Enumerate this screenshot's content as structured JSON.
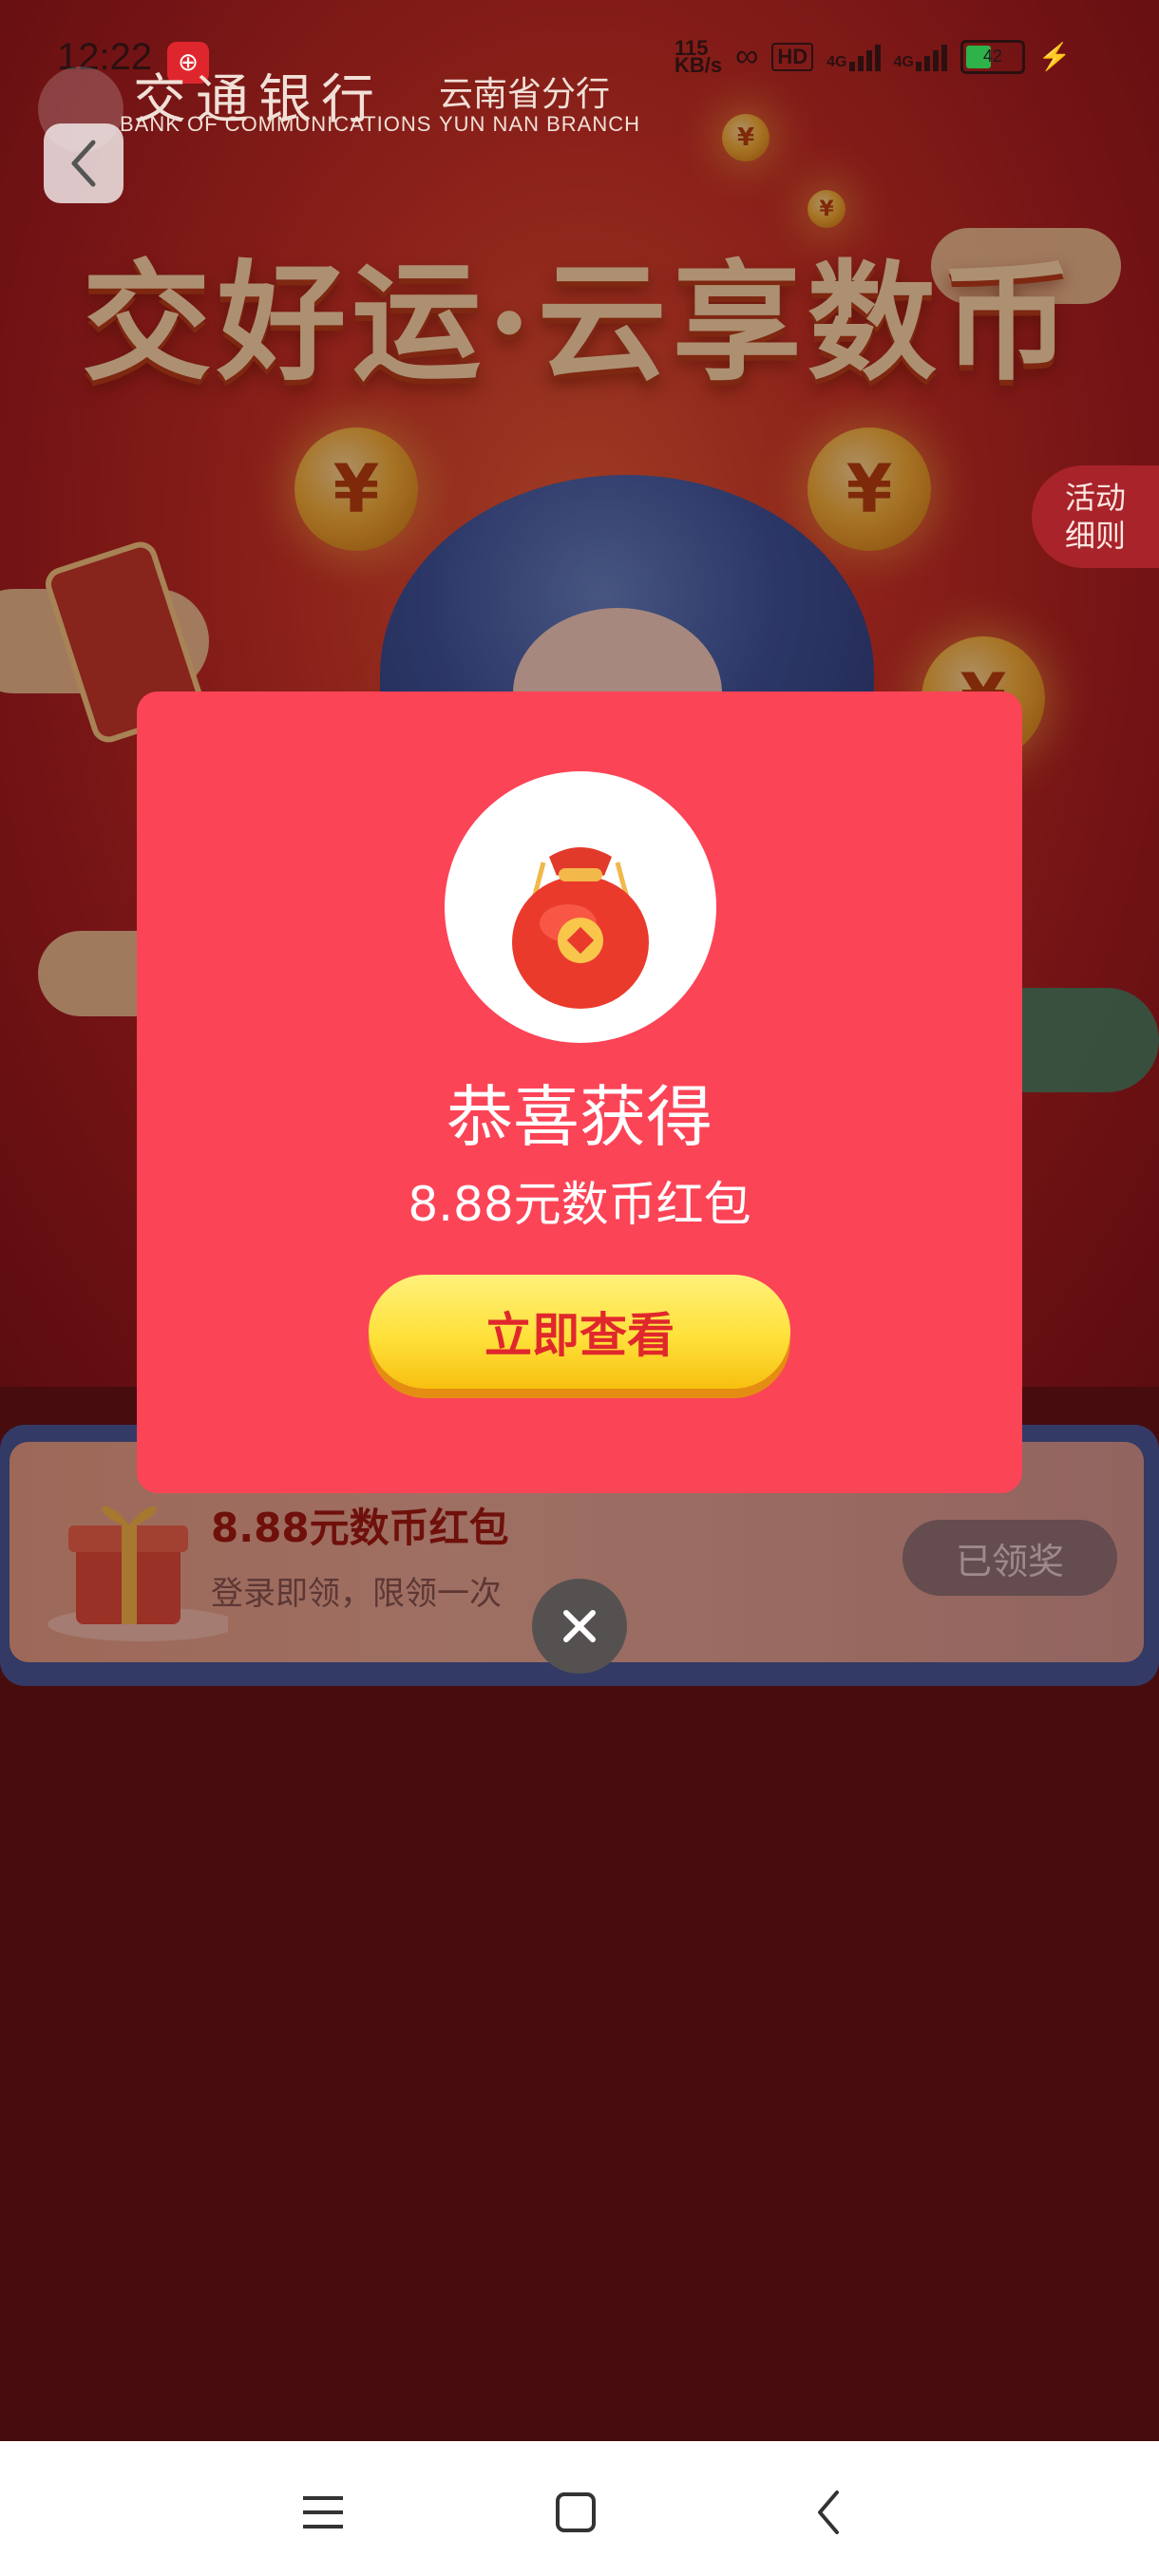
{
  "status_bar": {
    "time": "12:22",
    "app_badge": "⊕",
    "network_speed": "115\nKB/s",
    "hd": "HD",
    "net_a": "4G",
    "net_b": "4G",
    "battery": "42",
    "battery_level": 0.42
  },
  "bank": {
    "name_cn": "交通银行",
    "name_en": "BANK OF COMMUNICATIONS",
    "branch_cn": "云南省分行",
    "branch_en": "YUN NAN BRANCH"
  },
  "hero": {
    "title": "交好运·云享数币"
  },
  "rules_tab": {
    "label": "活动\n细则"
  },
  "task": {
    "title": "8.88元数币红包",
    "subtitle": "登录即领，限领一次",
    "button_label": "已领奖"
  },
  "popup": {
    "title": "恭喜获得",
    "amount": "8.88元数币红包",
    "button_label": "立即查看"
  },
  "colors": {
    "popup_bg": "#fc4457",
    "button_yellow": "#ffe13a",
    "page_bg": "#5b1416"
  }
}
